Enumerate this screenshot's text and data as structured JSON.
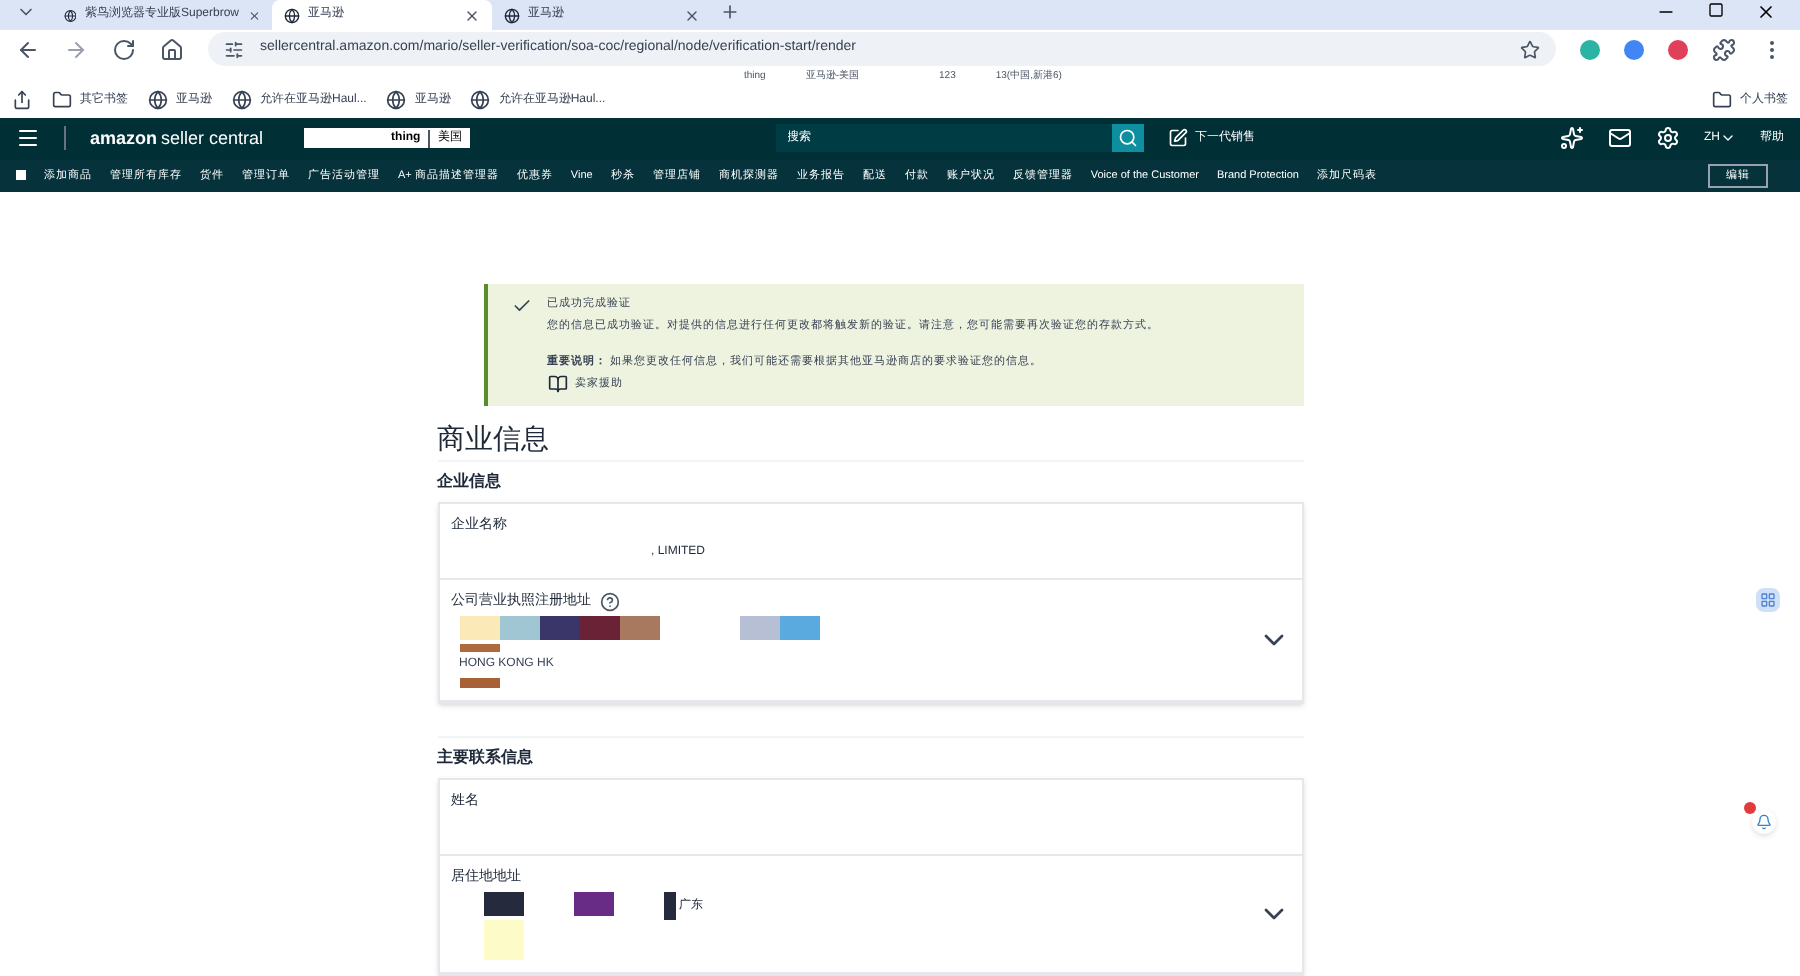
{
  "browser": {
    "tabs": [
      {
        "label": "紫鸟浏览器专业版Superbrow",
        "selected": false
      },
      {
        "label": "亚马逊",
        "selected": true
      },
      {
        "label": "亚马逊",
        "selected": false
      }
    ],
    "url": "sellercentral.amazon.com/mario/seller-verification/soa-coc/regional/node/verification-start/render",
    "overlay_texts": [
      "thing",
      "亚马逊-美国",
      "123",
      "13(中国,新港6)"
    ],
    "bookmarks": [
      {
        "label": "其它书签",
        "kind": "folder"
      },
      {
        "label": "亚马逊",
        "kind": "site"
      },
      {
        "label": "允许在亚马逊Haul...",
        "kind": "site"
      },
      {
        "label": "亚马逊",
        "kind": "site"
      },
      {
        "label": "允许在亚马逊Haul...",
        "kind": "site"
      }
    ],
    "personal_bookmarks": "个人书签"
  },
  "header": {
    "logo_main": "amazon",
    "logo_sub": "seller central",
    "store": "thing",
    "marketplace": "美国",
    "search_placeholder": "搜索",
    "next_gen": "下一代销售",
    "language": "ZH",
    "help": "帮助"
  },
  "nav": {
    "items": [
      "添加商品",
      "管理所有库存",
      "货件",
      "管理订单",
      "广告活动管理",
      "A+ 商品描述管理器",
      "优惠券",
      "Vine",
      "秒杀",
      "管理店铺",
      "商机探测器",
      "业务报告",
      "配送",
      "付款",
      "账户状况",
      "反馈管理器",
      "Voice of the Customer",
      "Brand Protection",
      "添加尺码表"
    ],
    "edit": "编辑"
  },
  "alert": {
    "title": "已成功完成验证",
    "body": "您的信息已成功验证。对提供的信息进行任何更改都将触发新的验证。请注意，您可能需要再次验证您的存款方式。",
    "note": "**重要说明：** 如果您更改任何信息，我们可能还需要根据其他亚马逊商店的要求验证您的信息。",
    "link": "卖家援助"
  },
  "page_title": "商业信息",
  "sections": [
    {
      "title": "企业信息",
      "fields": [
        {
          "label": "企业名称",
          "kind": "text",
          "value": ", LIMITED"
        },
        {
          "label": "公司营业执照注册地址",
          "kind": "address",
          "help": true,
          "value": "HONG KONG HK",
          "expandable": true
        }
      ]
    },
    {
      "title": "主要联系信息",
      "fields": [
        {
          "label": "姓名",
          "kind": "text"
        },
        {
          "label": "居住地地址",
          "kind": "residence",
          "value": "广东",
          "expandable": true
        }
      ]
    }
  ]
}
